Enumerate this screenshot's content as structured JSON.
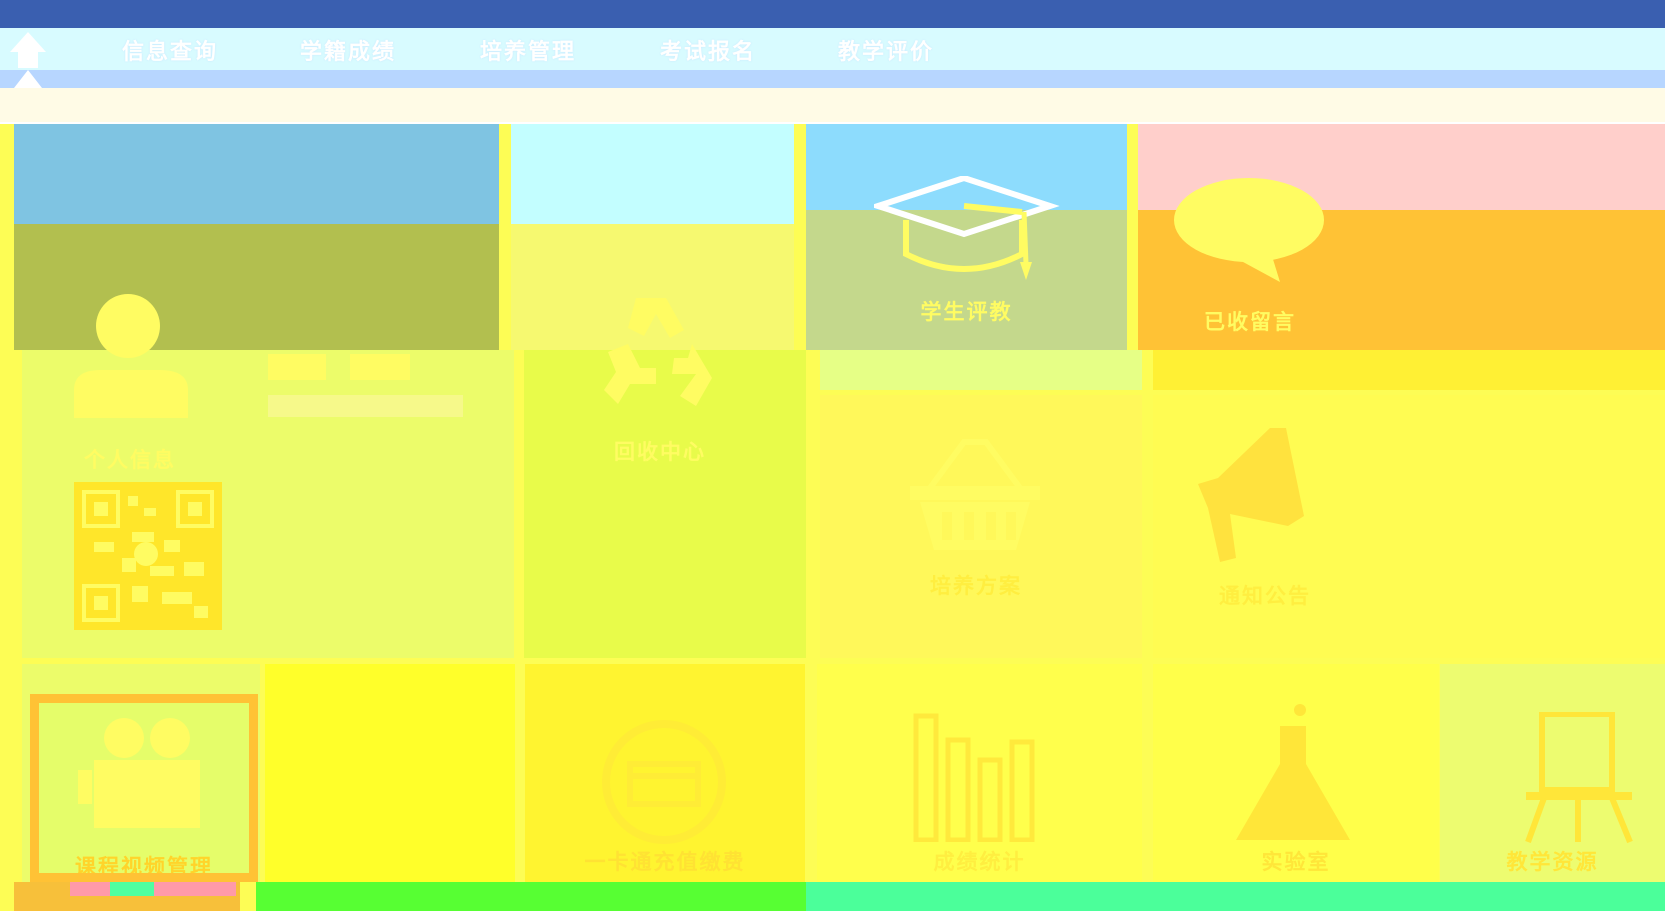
{
  "nav": {
    "home_label": "首",
    "items": [
      {
        "label": "信息查询"
      },
      {
        "label": "学籍成绩"
      },
      {
        "label": "培养管理"
      },
      {
        "label": "考试报名"
      },
      {
        "label": "教学评价"
      }
    ]
  },
  "tiles": {
    "student_eval": {
      "label": "学生评教"
    },
    "messages": {
      "label": "已收留言"
    },
    "personal": {
      "label": "个人信息"
    },
    "recycle": {
      "label": "回收中心"
    },
    "basket": {
      "label": "培养方案"
    },
    "notice": {
      "label": "通知公告"
    },
    "camera": {
      "label": "课程视频管理"
    },
    "card": {
      "label": "一卡通充值缴费"
    },
    "stats": {
      "label": "成绩统计"
    },
    "lab": {
      "label": "实验室"
    },
    "teacher": {
      "label": "教学资源"
    }
  },
  "colors": {
    "tile_blue": "#7fc4e2",
    "tile_cyan": "#c3feff",
    "tile_sky": "#8ddcfd",
    "tile_pink": "#ffcfcb",
    "overlay_olive": "#b2bf4f",
    "overlay_yellow": "#f6f970",
    "overlay_sage": "#c4d88c",
    "overlay_orange": "#ffc235",
    "body_yellow": "#fdfd55",
    "green_bar": "#57ff33",
    "mint_bar": "#4bff9a"
  }
}
